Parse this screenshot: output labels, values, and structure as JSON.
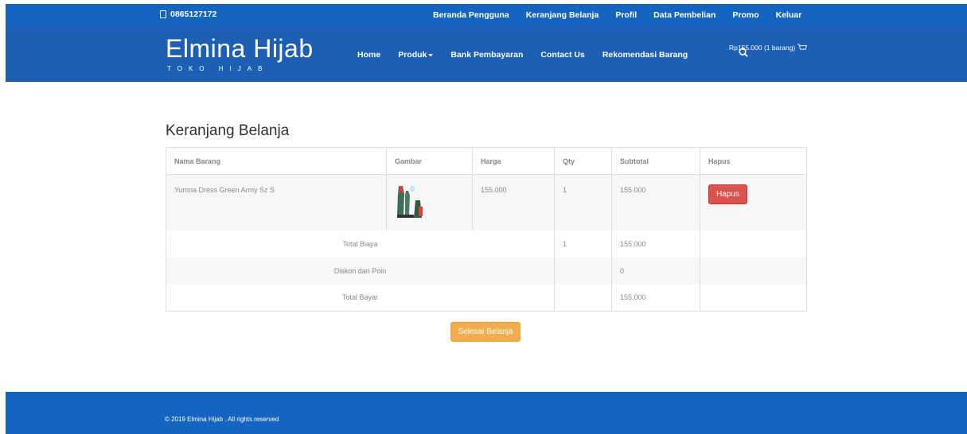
{
  "topbar": {
    "phone": "0865127172",
    "links": [
      "Beranda Pengguna",
      "Keranjang Belanja",
      "Profil",
      "Data Pembelian",
      "Promo",
      "Keluar"
    ]
  },
  "header": {
    "logo": "Elmina Hijab",
    "tagline": "TOKO HIJAB",
    "nav": {
      "home": "Home",
      "produk": "Produk",
      "bank": "Bank Pembayaran",
      "contact": "Contact Us",
      "rekomendasi": "Rekomendasi Barang"
    },
    "cart_summary": "Rp155.000 (1 barang)"
  },
  "cart": {
    "title": "Keranjang Belanja",
    "columns": [
      "Nama Barang",
      "Gambar",
      "Harga",
      "Qty",
      "Subtotal",
      "Hapus"
    ],
    "items": [
      {
        "name": "Yumna Dress Green Army Sz S",
        "price": "155.000",
        "qty": "1",
        "subtotal": "155.000",
        "delete_label": "Hapus"
      }
    ],
    "total_biaya_label": "Total Biaya",
    "total_biaya_qty": "1",
    "total_biaya_value": "155.000",
    "diskon_label": "Diskon dari Poin",
    "diskon_value": "0",
    "total_bayar_label": "Total Bayar",
    "total_bayar_value": "155.000",
    "checkout_label": "Selesai Belanja"
  },
  "footer": {
    "copyright": "© 2019 Elmina Hijab . All rights reserved"
  },
  "colors": {
    "topbar": "#1565c0",
    "header": "#1d5fb4",
    "danger": "#d9534f",
    "warning": "#f0ad4e"
  }
}
